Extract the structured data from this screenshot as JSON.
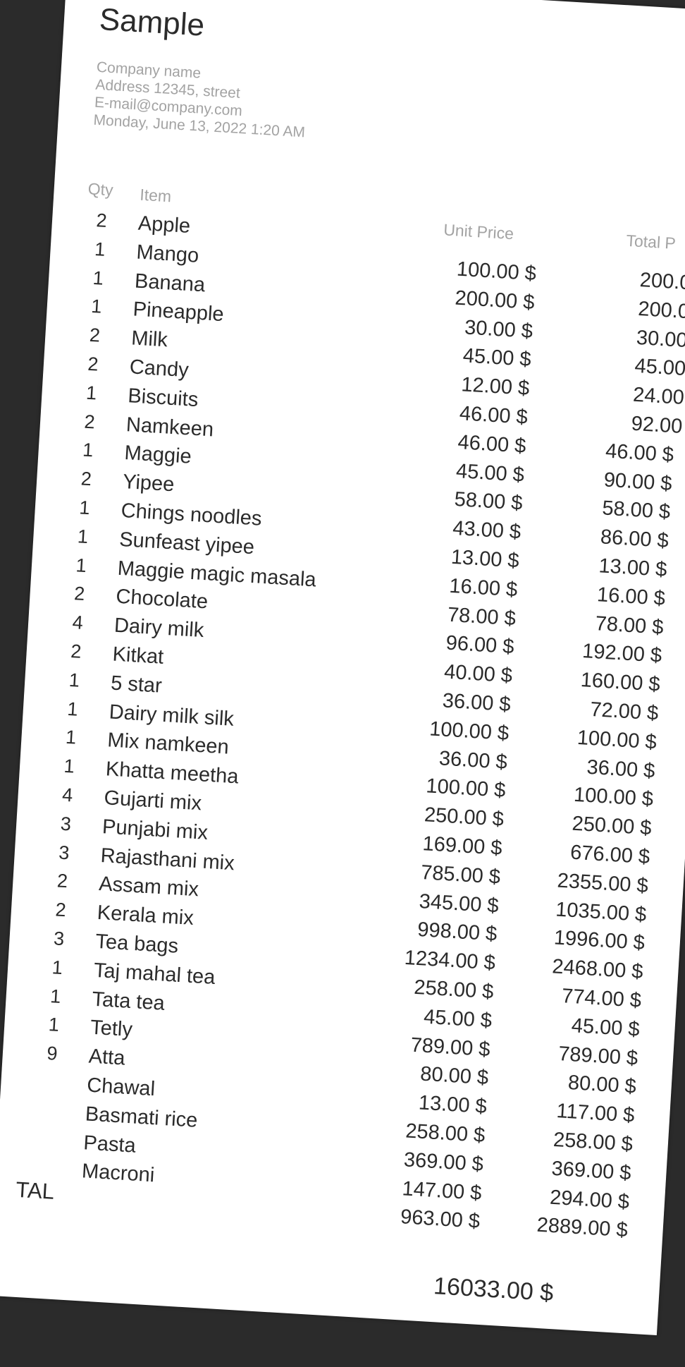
{
  "receipt": {
    "title": "Sample",
    "company_name": "Company name",
    "address": "Address 12345, street",
    "email": "E-mail@company.com",
    "datetime": "Monday, June 13, 2022 1:20 AM",
    "headers": {
      "qty": "Qty",
      "item": "Item",
      "unit_price": "Unit Price",
      "total_price": "Total P"
    },
    "items": [
      {
        "qty": "2",
        "name": "Apple"
      },
      {
        "qty": "1",
        "name": "Mango"
      },
      {
        "qty": "1",
        "name": "Banana"
      },
      {
        "qty": "1",
        "name": "Pineapple"
      },
      {
        "qty": "2",
        "name": "Milk"
      },
      {
        "qty": "2",
        "name": "Candy"
      },
      {
        "qty": "1",
        "name": "Biscuits"
      },
      {
        "qty": "2",
        "name": "Namkeen"
      },
      {
        "qty": "1",
        "name": "Maggie"
      },
      {
        "qty": "2",
        "name": "Yipee"
      },
      {
        "qty": "1",
        "name": "Chings noodles"
      },
      {
        "qty": "1",
        "name": "Sunfeast yipee"
      },
      {
        "qty": "1",
        "name": "Maggie magic masala"
      },
      {
        "qty": "2",
        "name": "Chocolate"
      },
      {
        "qty": "4",
        "name": "Dairy milk"
      },
      {
        "qty": "2",
        "name": "Kitkat"
      },
      {
        "qty": "1",
        "name": "5 star"
      },
      {
        "qty": "1",
        "name": "Dairy milk silk"
      },
      {
        "qty": "1",
        "name": "Mix namkeen"
      },
      {
        "qty": "1",
        "name": "Khatta meetha"
      },
      {
        "qty": "4",
        "name": "Gujarti mix"
      },
      {
        "qty": "3",
        "name": "Punjabi mix"
      },
      {
        "qty": "3",
        "name": "Rajasthani mix"
      },
      {
        "qty": "2",
        "name": "Assam mix"
      },
      {
        "qty": "2",
        "name": "Kerala mix"
      },
      {
        "qty": "3",
        "name": "Tea bags"
      },
      {
        "qty": "1",
        "name": "Taj mahal tea"
      },
      {
        "qty": "1",
        "name": "Tata tea"
      },
      {
        "qty": "1",
        "name": "Tetly"
      },
      {
        "qty": "9",
        "name": "Atta"
      },
      {
        "qty": "",
        "name": "Chawal"
      },
      {
        "qty": "",
        "name": "Basmati rice"
      },
      {
        "qty": "",
        "name": "Pasta"
      },
      {
        "qty": "",
        "name": "Macroni"
      }
    ],
    "unit_prices": [
      "100.00 $",
      "200.00 $",
      "30.00 $",
      "45.00 $",
      "12.00 $",
      "46.00 $",
      "46.00 $",
      "45.00 $",
      "58.00 $",
      "43.00 $",
      "13.00 $",
      "16.00 $",
      "78.00 $",
      "96.00 $",
      "40.00 $",
      "36.00 $",
      "100.00 $",
      "36.00 $",
      "100.00 $",
      "250.00 $",
      "169.00 $",
      "785.00 $",
      "345.00 $",
      "998.00 $",
      "1234.00 $",
      "258.00 $",
      "45.00 $",
      "789.00 $",
      "80.00 $",
      "13.00 $",
      "258.00 $",
      "369.00 $",
      "147.00 $",
      "963.00 $"
    ],
    "total_prices": [
      "200.0",
      "200.0",
      "30.00",
      "45.00",
      "24.00",
      "92.00",
      "46.00 $",
      "90.00 $",
      "58.00 $",
      "86.00 $",
      "13.00 $",
      "16.00 $",
      "78.00 $",
      "192.00 $",
      "160.00 $",
      "72.00 $",
      "100.00 $",
      "36.00 $",
      "100.00 $",
      "250.00 $",
      "676.00 $",
      "2355.00 $",
      "1035.00 $",
      "1996.00 $",
      "2468.00 $",
      "774.00 $",
      "45.00 $",
      "789.00 $",
      "80.00 $",
      "117.00 $",
      "258.00 $",
      "369.00 $",
      "294.00 $",
      "2889.00 $"
    ],
    "total_label": "TAL",
    "grand_total": "16033.00 $"
  }
}
